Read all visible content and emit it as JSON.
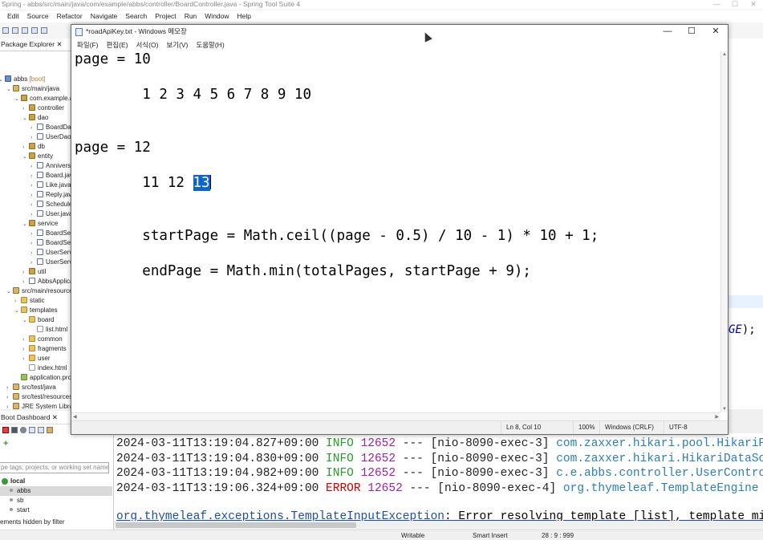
{
  "ide": {
    "title": "Spring - abbs/src/main/java/com/example/abbs/controller/BoardController.java - Spring Tool Suite 4",
    "menu": [
      "Edit",
      "Source",
      "Refactor",
      "Navigate",
      "Search",
      "Project",
      "Run",
      "Window",
      "Help"
    ],
    "win_controls": [
      "—",
      "☐",
      "✕"
    ]
  },
  "package_explorer": {
    "tab_label": "Package Explorer",
    "close": "✕",
    "items": [
      {
        "label": "abbs [boot]",
        "icon": "project-icon",
        "indent": 0,
        "arrow": "v"
      },
      {
        "label": "src/main/java",
        "icon": "source-folder-icon",
        "indent": 1,
        "arrow": "v"
      },
      {
        "label": "com.example.a",
        "icon": "package-icon",
        "indent": 2,
        "arrow": "v"
      },
      {
        "label": "controller",
        "icon": "package-icon",
        "indent": 3,
        "arrow": ">"
      },
      {
        "label": "dao",
        "icon": "package-icon",
        "indent": 3,
        "arrow": "v"
      },
      {
        "label": "BoardDao",
        "icon": "java-file-icon",
        "indent": 4,
        "arrow": ">"
      },
      {
        "label": "UserDao.j",
        "icon": "java-file-icon",
        "indent": 4,
        "arrow": ">"
      },
      {
        "label": "db",
        "icon": "package-icon",
        "indent": 3,
        "arrow": ">"
      },
      {
        "label": "entity",
        "icon": "package-icon",
        "indent": 3,
        "arrow": "v"
      },
      {
        "label": "Anniversa",
        "icon": "java-file-icon",
        "indent": 4,
        "arrow": ">"
      },
      {
        "label": "Board.java",
        "icon": "java-file-icon",
        "indent": 4,
        "arrow": ">"
      },
      {
        "label": "Like.java",
        "icon": "java-file-icon",
        "indent": 4,
        "arrow": ">"
      },
      {
        "label": "Reply.java",
        "icon": "java-file-icon",
        "indent": 4,
        "arrow": ">"
      },
      {
        "label": "Schedule.",
        "icon": "java-file-icon",
        "indent": 4,
        "arrow": ">"
      },
      {
        "label": "User.java",
        "icon": "java-file-icon",
        "indent": 4,
        "arrow": ">"
      },
      {
        "label": "service",
        "icon": "package-icon",
        "indent": 3,
        "arrow": "v"
      },
      {
        "label": "BoardServ",
        "icon": "java-file-icon",
        "indent": 4,
        "arrow": ">"
      },
      {
        "label": "BoardServ",
        "icon": "java-file-icon",
        "indent": 4,
        "arrow": ">"
      },
      {
        "label": "UserServic",
        "icon": "java-file-icon",
        "indent": 4,
        "arrow": ">"
      },
      {
        "label": "UserServic",
        "icon": "java-file-icon",
        "indent": 4,
        "arrow": ">"
      },
      {
        "label": "util",
        "icon": "package-icon",
        "indent": 3,
        "arrow": ">"
      },
      {
        "label": "AbbsApplica",
        "icon": "java-file-icon",
        "indent": 3,
        "arrow": ">"
      },
      {
        "label": "src/main/resources",
        "icon": "source-folder-icon",
        "indent": 1,
        "arrow": "v"
      },
      {
        "label": "static",
        "icon": "folder-icon",
        "indent": 2,
        "arrow": ">"
      },
      {
        "label": "templates",
        "icon": "folder-icon",
        "indent": 2,
        "arrow": "v"
      },
      {
        "label": "board",
        "icon": "folder-icon",
        "indent": 3,
        "arrow": "v"
      },
      {
        "label": "list.html",
        "icon": "html-file-icon",
        "indent": 4,
        "arrow": ""
      },
      {
        "label": "common",
        "icon": "folder-icon",
        "indent": 3,
        "arrow": ">"
      },
      {
        "label": "fragments",
        "icon": "folder-icon",
        "indent": 3,
        "arrow": ">"
      },
      {
        "label": "user",
        "icon": "folder-icon",
        "indent": 3,
        "arrow": ">"
      },
      {
        "label": "index.html",
        "icon": "html-file-icon",
        "indent": 3,
        "arrow": ""
      },
      {
        "label": "application.prop",
        "icon": "properties-file-icon",
        "indent": 2,
        "arrow": ""
      },
      {
        "label": "src/test/java",
        "icon": "source-folder-icon",
        "indent": 1,
        "arrow": ">"
      },
      {
        "label": "src/test/resources",
        "icon": "source-folder-icon",
        "indent": 1,
        "arrow": ">"
      },
      {
        "label": "JRE System Library",
        "icon": "library-icon",
        "indent": 1,
        "arrow": ">"
      }
    ]
  },
  "boot_dashboard": {
    "tab_label": "Boot Dashboard",
    "close": "✕",
    "filter_placeholder": "pe tags, projects, or working set name",
    "group": "local",
    "apps": [
      "abbs",
      "sb",
      "start"
    ],
    "footer": "ements hidden by filter"
  },
  "notepad": {
    "title": "*roadApiKey.txt - Windows 메모장",
    "menu": [
      "파일(F)",
      "편집(E)",
      "서식(O)",
      "보기(V)",
      "도움말(H)"
    ],
    "controls": [
      "—",
      "☐",
      "✕"
    ],
    "lines": [
      {
        "pre": "page = 10",
        "sel": "",
        "post": ""
      },
      {
        "pre": "",
        "sel": "",
        "post": ""
      },
      {
        "pre": "        1 2 3 4 5 6 7 8 9 10",
        "sel": "",
        "post": ""
      },
      {
        "pre": "",
        "sel": "",
        "post": ""
      },
      {
        "pre": "",
        "sel": "",
        "post": ""
      },
      {
        "pre": "page = 12",
        "sel": "",
        "post": ""
      },
      {
        "pre": "",
        "sel": "",
        "post": ""
      },
      {
        "pre": "        11 12 ",
        "sel": "13",
        "post": ""
      },
      {
        "pre": "",
        "sel": "",
        "post": ""
      },
      {
        "pre": "",
        "sel": "",
        "post": ""
      },
      {
        "pre": "        startPage = Math.ceil((page - 0.5) / 10 - 1) * 10 + 1;",
        "sel": "",
        "post": ""
      },
      {
        "pre": "",
        "sel": "",
        "post": ""
      },
      {
        "pre": "        endPage = Math.min(totalPages, startPage + 9);",
        "sel": "",
        "post": ""
      }
    ],
    "status": {
      "position": "Ln 8, Col 10",
      "zoom": "100%",
      "line_ending": "Windows (CRLF)",
      "encoding": "UTF-8"
    }
  },
  "editor_bg": {
    "fragment_const": "GE",
    "fragment_tail": ");"
  },
  "console": {
    "lines": [
      {
        "ts": "2024-03-11T13:19:04.827+09:00",
        "level": " INFO",
        "pid": "12652",
        "thread": "--- [nio-8090-exec-3]",
        "logger": "com.zaxxer.hikari.pool.HikariPool"
      },
      {
        "ts": "2024-03-11T13:19:04.830+09:00",
        "level": " INFO",
        "pid": "12652",
        "thread": "--- [nio-8090-exec-3]",
        "logger": "com.zaxxer.hikari.HikariDataSource"
      },
      {
        "ts": "2024-03-11T13:19:04.982+09:00",
        "level": " INFO",
        "pid": "12652",
        "thread": "--- [nio-8090-exec-3]",
        "logger": "c.e.abbs.controller.UserController"
      },
      {
        "ts": "2024-03-11T13:19:06.324+09:00",
        "level": "ERROR",
        "pid": "12652",
        "thread": "--- [nio-8090-exec-4]",
        "logger": "org.thymeleaf.TemplateEngine"
      }
    ],
    "exception": "org.thymeleaf.exceptions.TemplateInputException",
    "exception_msg": ": Error resolving template [list], template might not"
  },
  "ide_status": {
    "writable": "Writable",
    "mode": "Smart Insert",
    "position": "28 : 9 : 999"
  }
}
